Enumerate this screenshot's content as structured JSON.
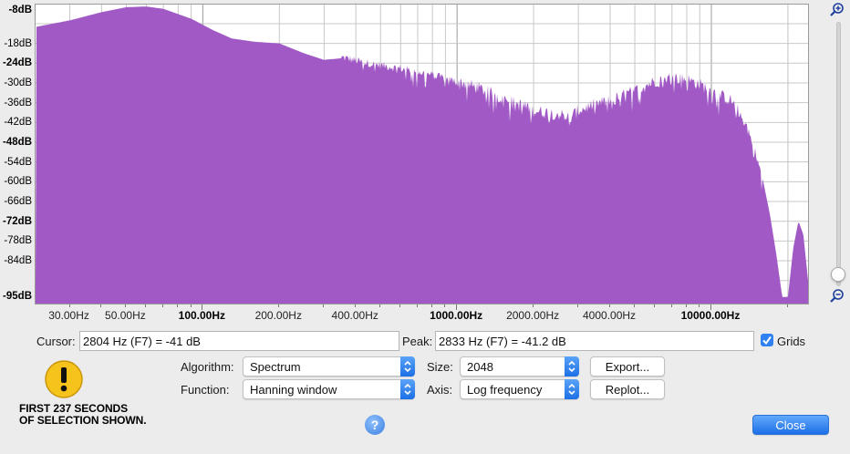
{
  "spectrum": {
    "y_labels": [
      "-8dB",
      "-18dB",
      "-24dB",
      "-30dB",
      "-36dB",
      "-42dB",
      "-48dB",
      "-54dB",
      "-60dB",
      "-66dB",
      "-72dB",
      "-78dB",
      "-84dB",
      "-95dB"
    ],
    "x_labels": [
      "30.00Hz",
      "50.00Hz",
      "100.00Hz",
      "200.00Hz",
      "400.00Hz",
      "1000.00Hz",
      "2000.00Hz",
      "4000.00Hz",
      "10000.00Hz"
    ],
    "fill_color": "#a15ac5",
    "grid_color": "#c8c8c8",
    "grid_visible": true,
    "scale": "log frequency",
    "envelope": [
      {
        "hz": 22,
        "db": -13
      },
      {
        "hz": 30,
        "db": -11
      },
      {
        "hz": 40,
        "db": -8.5
      },
      {
        "hz": 50,
        "db": -7
      },
      {
        "hz": 60,
        "db": -6.8
      },
      {
        "hz": 70,
        "db": -7.5
      },
      {
        "hz": 90,
        "db": -10.5
      },
      {
        "hz": 110,
        "db": -14
      },
      {
        "hz": 130,
        "db": -16.5
      },
      {
        "hz": 160,
        "db": -17.5
      },
      {
        "hz": 200,
        "db": -18
      },
      {
        "hz": 250,
        "db": -21
      },
      {
        "hz": 300,
        "db": -23
      },
      {
        "hz": 350,
        "db": -22.5
      },
      {
        "hz": 420,
        "db": -24
      },
      {
        "hz": 500,
        "db": -25
      },
      {
        "hz": 600,
        "db": -26
      },
      {
        "hz": 700,
        "db": -27
      },
      {
        "hz": 800,
        "db": -28
      },
      {
        "hz": 1000,
        "db": -30
      },
      {
        "hz": 1200,
        "db": -32
      },
      {
        "hz": 1500,
        "db": -35
      },
      {
        "hz": 2000,
        "db": -39
      },
      {
        "hz": 2500,
        "db": -40
      },
      {
        "hz": 2800,
        "db": -41
      },
      {
        "hz": 3000,
        "db": -39
      },
      {
        "hz": 3500,
        "db": -37
      },
      {
        "hz": 4000,
        "db": -36
      },
      {
        "hz": 5000,
        "db": -33
      },
      {
        "hz": 6000,
        "db": -30
      },
      {
        "hz": 7000,
        "db": -29
      },
      {
        "hz": 8000,
        "db": -29.5
      },
      {
        "hz": 9000,
        "db": -31
      },
      {
        "hz": 10000,
        "db": -33
      },
      {
        "hz": 12000,
        "db": -36
      },
      {
        "hz": 13000,
        "db": -40
      },
      {
        "hz": 14000,
        "db": -45
      },
      {
        "hz": 15000,
        "db": -53
      },
      {
        "hz": 16000,
        "db": -60
      },
      {
        "hz": 17000,
        "db": -70
      },
      {
        "hz": 18000,
        "db": -82
      },
      {
        "hz": 19000,
        "db": -95
      },
      {
        "hz": 20000,
        "db": -95
      },
      {
        "hz": 21000,
        "db": -80
      },
      {
        "hz": 22000,
        "db": -72
      },
      {
        "hz": 23000,
        "db": -76
      },
      {
        "hz": 24000,
        "db": -90
      }
    ]
  },
  "controls": {
    "cursor_label": "Cursor:",
    "cursor_value": "2804 Hz (F7) = -41 dB",
    "peak_label": "Peak:",
    "peak_value": "2833 Hz (F7) = -41.2 dB",
    "grids_label": "Grids",
    "grids_checked": true,
    "algorithm_label": "Algorithm:",
    "algorithm_value": "Spectrum",
    "function_label": "Function:",
    "function_value": "Hanning window",
    "size_label": "Size:",
    "size_value": "2048",
    "axis_label": "Axis:",
    "axis_value": "Log frequency",
    "export_label": "Export...",
    "replot_label": "Replot...",
    "close_label": "Close",
    "accent_color": "#2f80f0"
  },
  "warning": {
    "line1": "FIRST 237 SECONDS",
    "line2": "OF SELECTION SHOWN."
  },
  "icons": {
    "zoom_in": "zoom-in-icon",
    "zoom_out": "zoom-out-icon",
    "warning": "warning-icon",
    "help": "help-icon"
  }
}
